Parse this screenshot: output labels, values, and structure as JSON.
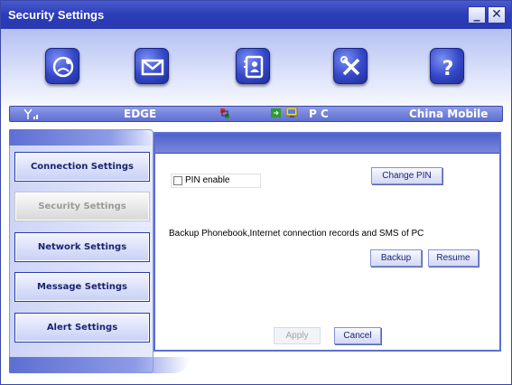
{
  "window": {
    "title": "Security Settings",
    "minimize": "_",
    "close": "✕"
  },
  "toolbar": [
    {
      "name": "connection-icon"
    },
    {
      "name": "message-icon"
    },
    {
      "name": "phonebook-icon"
    },
    {
      "name": "settings-tools-icon"
    },
    {
      "name": "help-icon"
    }
  ],
  "status": {
    "network_type": "EDGE",
    "pc_mode": "P C",
    "operator": "China Mobile"
  },
  "sidebar": {
    "items": [
      {
        "label": "Connection Settings",
        "active": false
      },
      {
        "label": "Security Settings",
        "active": true
      },
      {
        "label": "Network Settings",
        "active": false
      },
      {
        "label": "Message Settings",
        "active": false
      },
      {
        "label": "Alert Settings",
        "active": false
      }
    ]
  },
  "security": {
    "pin_enable_label": "PIN enable",
    "pin_enable_checked": false,
    "change_pin_label": "Change PIN",
    "backup_text": "Backup Phonebook,Internet connection records and SMS of PC",
    "backup_label": "Backup",
    "resume_label": "Resume",
    "apply_label": "Apply",
    "cancel_label": "Cancel"
  },
  "colors": {
    "accent": "#2c3cb8",
    "panel_border": "#5d6fd2"
  }
}
